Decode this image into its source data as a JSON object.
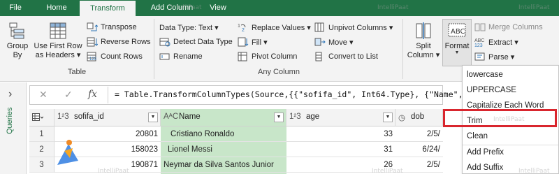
{
  "tabs": [
    "File",
    "Home",
    "Transform",
    "Add Column",
    "View"
  ],
  "ribbon": {
    "group_by": [
      "Group",
      "By"
    ],
    "use_first_row": [
      "Use First Row",
      "as Headers ▾"
    ],
    "transpose": "Transpose",
    "reverse_rows": "Reverse Rows",
    "count_rows": "Count Rows",
    "table_group": "Table",
    "data_type": "Data Type: Text ▾",
    "detect_data_type": "Detect Data Type",
    "rename": "Rename",
    "replace_values": "Replace Values ▾",
    "fill": "Fill ▾",
    "pivot_column": "Pivot Column",
    "unpivot_columns": "Unpivot Columns ▾",
    "move": "Move ▾",
    "convert_to_list": "Convert to List",
    "any_column_group": "Any Column",
    "split_column": [
      "Split",
      "Column ▾"
    ],
    "format": "Format",
    "merge_columns": "Merge Columns",
    "extract": "Extract ▾",
    "parse": "Parse ▾"
  },
  "sidebar": {
    "queries": "Queries",
    "expand_glyph": "›"
  },
  "formula_bar": {
    "cancel_glyph": "✕",
    "commit_glyph": "✓",
    "fx": "fx",
    "text": "= Table.TransformColumnTypes(Source,{{\"sofifa_id\", Int64.Type}, {\"Name\","
  },
  "grid": {
    "columns": [
      {
        "type": "1²3",
        "name": "sofifa_id"
      },
      {
        "type": "AᴬC",
        "name": "Name"
      },
      {
        "type": "1²3",
        "name": "age"
      },
      {
        "type": "◷",
        "name": "dob"
      }
    ],
    "rows": [
      {
        "num": "1",
        "sofifa_id": "20801",
        "name": "Cristiano Ronaldo",
        "age": "33",
        "dob": "2/5/"
      },
      {
        "num": "2",
        "sofifa_id": "158023",
        "name": "Lionel Messi",
        "age": "31",
        "dob": "6/24/"
      },
      {
        "num": "3",
        "sofifa_id": "190871",
        "name": "Neymar da Silva Santos Junior",
        "age": "26",
        "dob": "2/5/"
      }
    ]
  },
  "format_menu": [
    "lowercase",
    "UPPERCASE",
    "Capitalize Each Word",
    "Trim",
    "Clean",
    "Add Prefix",
    "Add Suffix"
  ],
  "watermark": "IntelliPaat",
  "colors": {
    "ribbon_green": "#217346",
    "selected_column": "#c8e6c9",
    "highlight_red": "#d9262e"
  }
}
